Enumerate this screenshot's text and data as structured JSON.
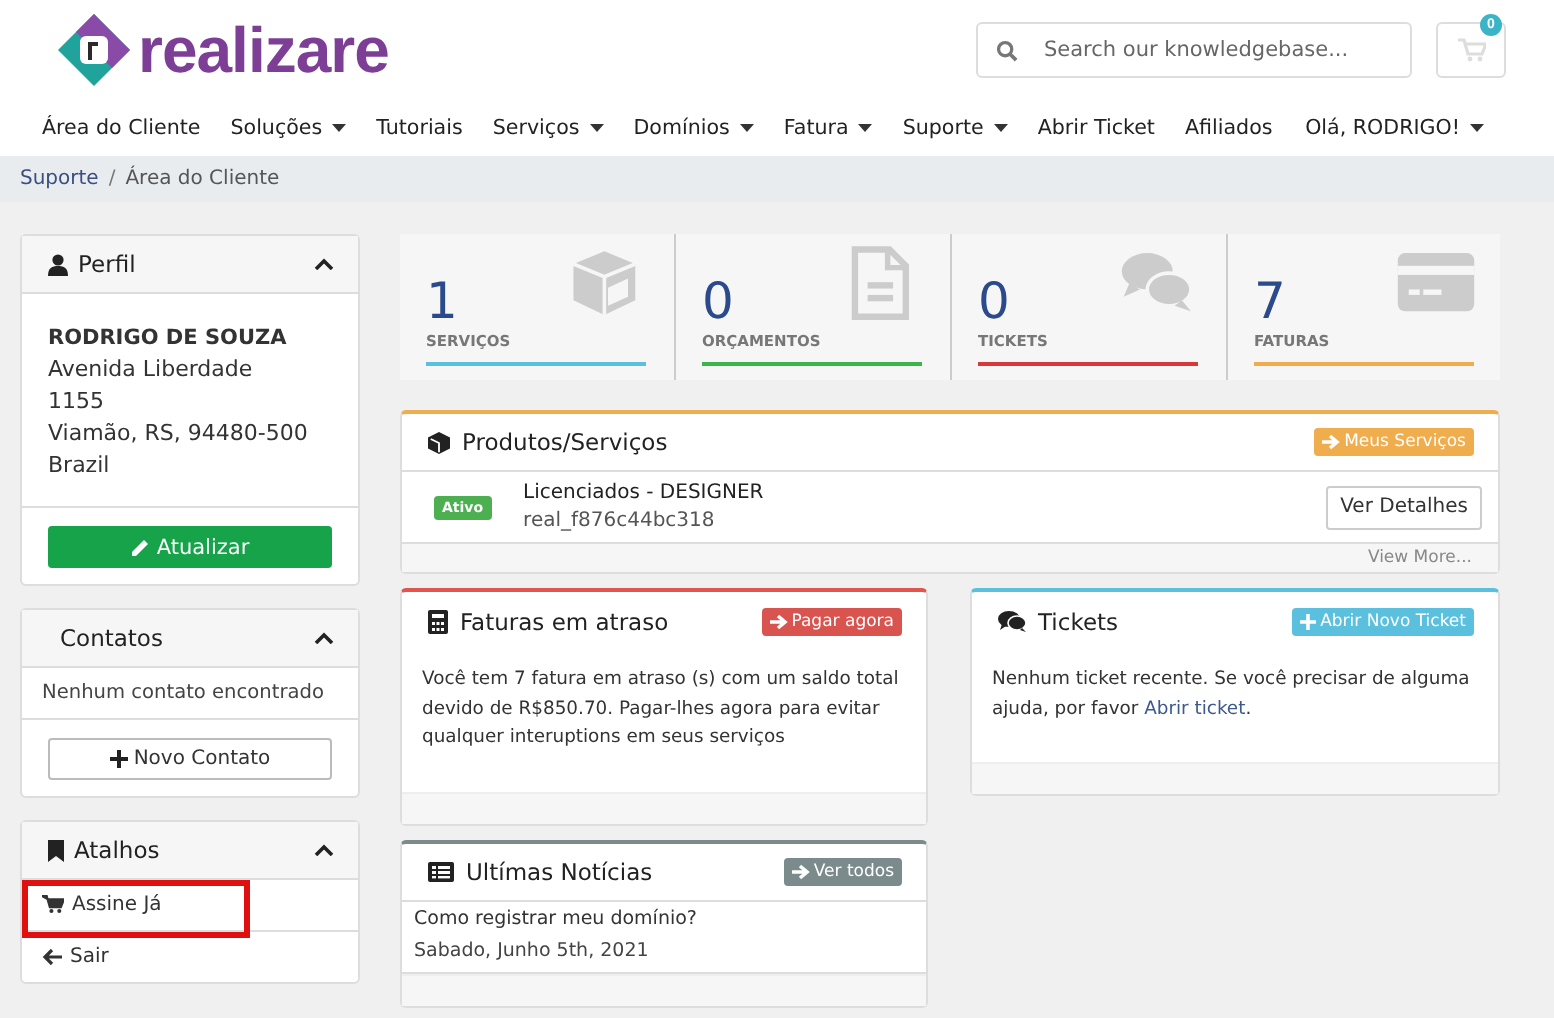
{
  "logo_text": "realizare",
  "search": {
    "placeholder": "Search our knowledgebase..."
  },
  "cart": {
    "count": "0"
  },
  "nav": [
    {
      "label": "Área do Cliente",
      "dropdown": false
    },
    {
      "label": "Soluções",
      "dropdown": true
    },
    {
      "label": "Tutoriais",
      "dropdown": false
    },
    {
      "label": "Serviços",
      "dropdown": true
    },
    {
      "label": "Domínios",
      "dropdown": true
    },
    {
      "label": "Fatura",
      "dropdown": true
    },
    {
      "label": "Suporte",
      "dropdown": true
    },
    {
      "label": "Abrir Ticket",
      "dropdown": false
    },
    {
      "label": "Afiliados",
      "dropdown": false
    }
  ],
  "user_menu": {
    "label": "Olá, RODRIGO!",
    "dropdown": true
  },
  "breadcrumb": {
    "items": [
      "Suporte",
      "Área do Cliente"
    ],
    "separator": "/"
  },
  "profile": {
    "title": "Perfil",
    "lines": [
      "RODRIGO DE SOUZA",
      "Avenida Liberdade",
      "1155",
      "Viamão, RS, 94480-500",
      "Brazil"
    ],
    "button": "Atualizar"
  },
  "contacts": {
    "title": "Contatos",
    "empty": "Nenhum contato encontrado",
    "button": "Novo Contato"
  },
  "shortcuts": {
    "title": "Atalhos",
    "items": [
      {
        "label": "Assine Já",
        "highlighted": true
      },
      {
        "label": "Sair",
        "highlighted": false
      }
    ]
  },
  "stats": [
    {
      "value": "1",
      "label": "SERVIÇOS",
      "color": "#5bc0de"
    },
    {
      "value": "0",
      "label": "ORÇAMENTOS",
      "color": "#3bb54a"
    },
    {
      "value": "0",
      "label": "TICKETS",
      "color": "#d9383a"
    },
    {
      "value": "7",
      "label": "FATURAS",
      "color": "#f0ad4e"
    }
  ],
  "products": {
    "title": "Produtos/Serviços",
    "button": "Meus Serviços",
    "items": [
      {
        "status": "Ativo",
        "name": "Licenciados - DESIGNER",
        "domain": "real_f876c44bc318",
        "action": "Ver Detalhes"
      }
    ],
    "more": "View More..."
  },
  "overdue": {
    "title": "Faturas em atraso",
    "button": "Pagar agora",
    "text": "Você tem 7 fatura em atraso (s) com um saldo total devido de R$850.70. Pagar-lhes agora para evitar qualquer interuptions em seus serviços"
  },
  "tickets": {
    "title": "Tickets",
    "button": "Abrir Novo Ticket",
    "text": "Nenhum ticket recente. Se você precisar de alguma ajuda, por favor",
    "link": "Abrir ticket",
    "after": "."
  },
  "news": {
    "title": "Ultímas Notícias",
    "button": "Ver todos",
    "items": [
      {
        "title": "Como registrar meu domínio?",
        "date": "Sabado, Junho 5th, 2021"
      }
    ]
  }
}
